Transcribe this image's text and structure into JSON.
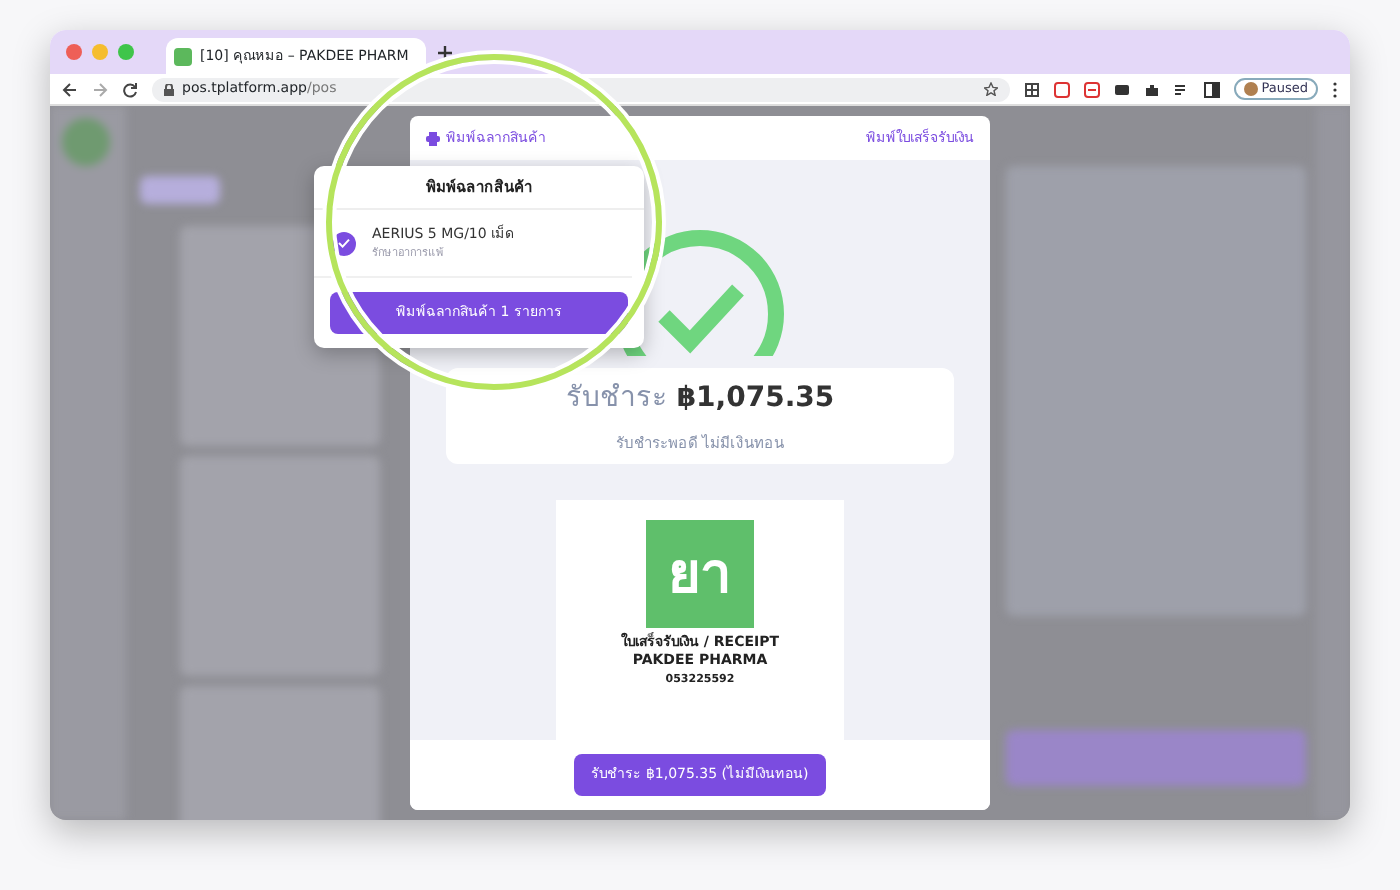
{
  "browser": {
    "tab": {
      "title": "[10] คุณหมอ – PAKDEE PHARM"
    },
    "url": {
      "host": "pos.tplatform.app",
      "path": "/pos"
    },
    "profile": {
      "label": "Paused"
    }
  },
  "modal": {
    "header": {
      "left_link": "พิมพ์ฉลากสินค้า",
      "right_link": "พิมพ์ใบเสร็จรับเงิน"
    },
    "summary": {
      "amount_label": "รับชำระ",
      "amount": "฿1,075.35",
      "note": "รับชำระพอดี ไม่มีเงินทอน"
    },
    "receipt": {
      "logo": "ยา",
      "title": "ใบเสร็จรับเงิน / RECEIPT",
      "store": "PAKDEE PHARMA",
      "phone": "053225592"
    },
    "confirm_button": "รับชำระ ฿1,075.35 (ไม่มีเงินทอน)"
  },
  "label_popover": {
    "title": "พิมพ์ฉลากสินค้า",
    "items": [
      {
        "name": "AERIUS 5 MG/10 เม็ด",
        "subtitle": "รักษาอาการแพ้",
        "checked": true
      }
    ],
    "print_button": "พิมพ์ฉลากสินค้า 1 รายการ"
  }
}
